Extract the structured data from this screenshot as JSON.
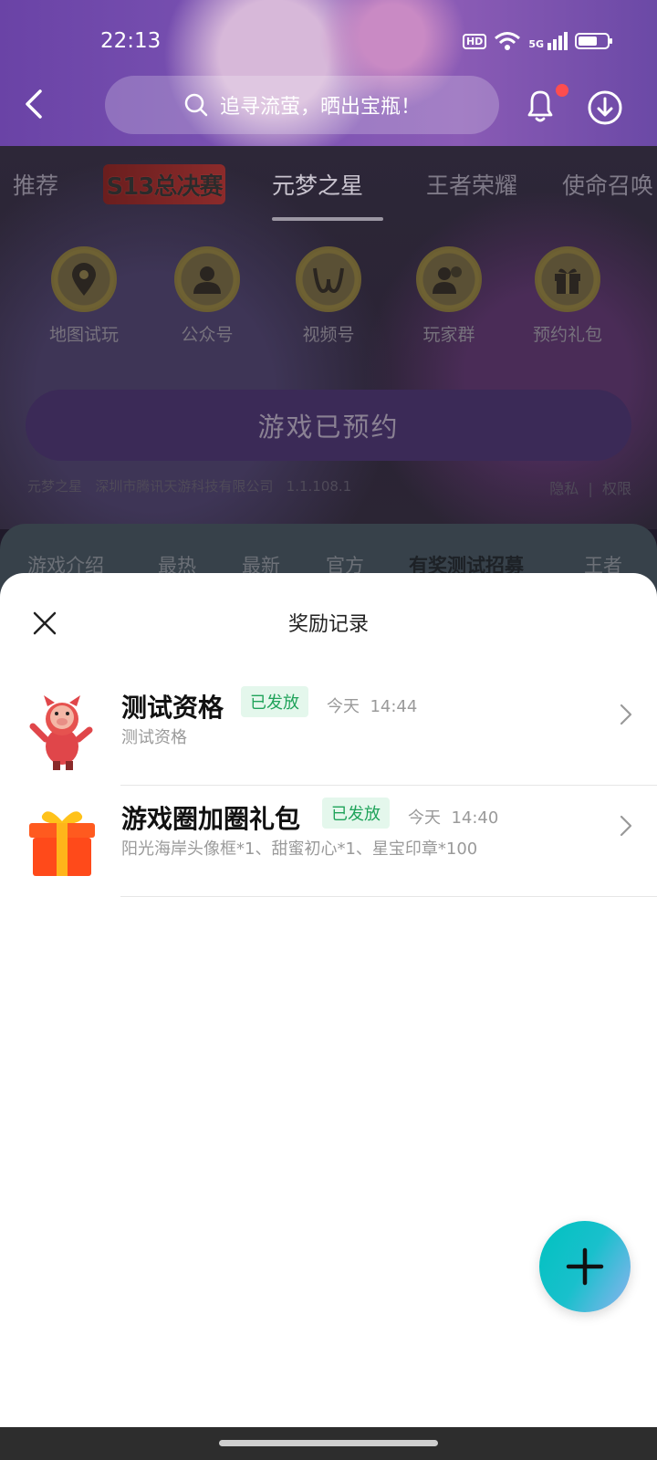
{
  "status_bar": {
    "time": "22:13",
    "hd": "HD",
    "network": "5G"
  },
  "header": {
    "search_placeholder": "追寻流萤，晒出宝瓶！",
    "icons": [
      "back-icon",
      "search-icon",
      "bell-icon",
      "download-icon"
    ]
  },
  "tabs": [
    "推荐",
    "S13总决赛",
    "元梦之星",
    "王者荣耀",
    "使命召唤"
  ],
  "active_tab": "元梦之星",
  "shortcuts": [
    {
      "label": "地图试玩",
      "icon": "map-pin-icon"
    },
    {
      "label": "公众号",
      "icon": "person-icon"
    },
    {
      "label": "视频号",
      "icon": "video-channel-icon"
    },
    {
      "label": "玩家群",
      "icon": "group-icon"
    },
    {
      "label": "预约礼包",
      "icon": "gift-icon"
    }
  ],
  "reserve_button": "游戏已预约",
  "meta": {
    "game": "元梦之星",
    "company": "深圳市腾讯天游科技有限公司",
    "version": "1.1.108.1",
    "privacy": "隐私",
    "permissions": "权限"
  },
  "content_tabs": [
    "游戏介绍",
    "最热",
    "最新",
    "官方",
    "有奖测试招募",
    "王者"
  ],
  "sheet": {
    "title": "奖励记录",
    "records": [
      {
        "name": "测试资格",
        "status": "已发放",
        "day": "今天",
        "time": "14:44",
        "desc": "测试资格",
        "thumb": "pig-mascot"
      },
      {
        "name": "游戏圈加圈礼包",
        "status": "已发放",
        "day": "今天",
        "time": "14:40",
        "desc": "阳光海岸头像框*1、甜蜜初心*1、星宝印章*100",
        "thumb": "gift-box"
      }
    ]
  },
  "colors": {
    "accent_green": "#1fa35a",
    "fab": "#00c2c0",
    "bell_dot": "#ff4d4f"
  }
}
